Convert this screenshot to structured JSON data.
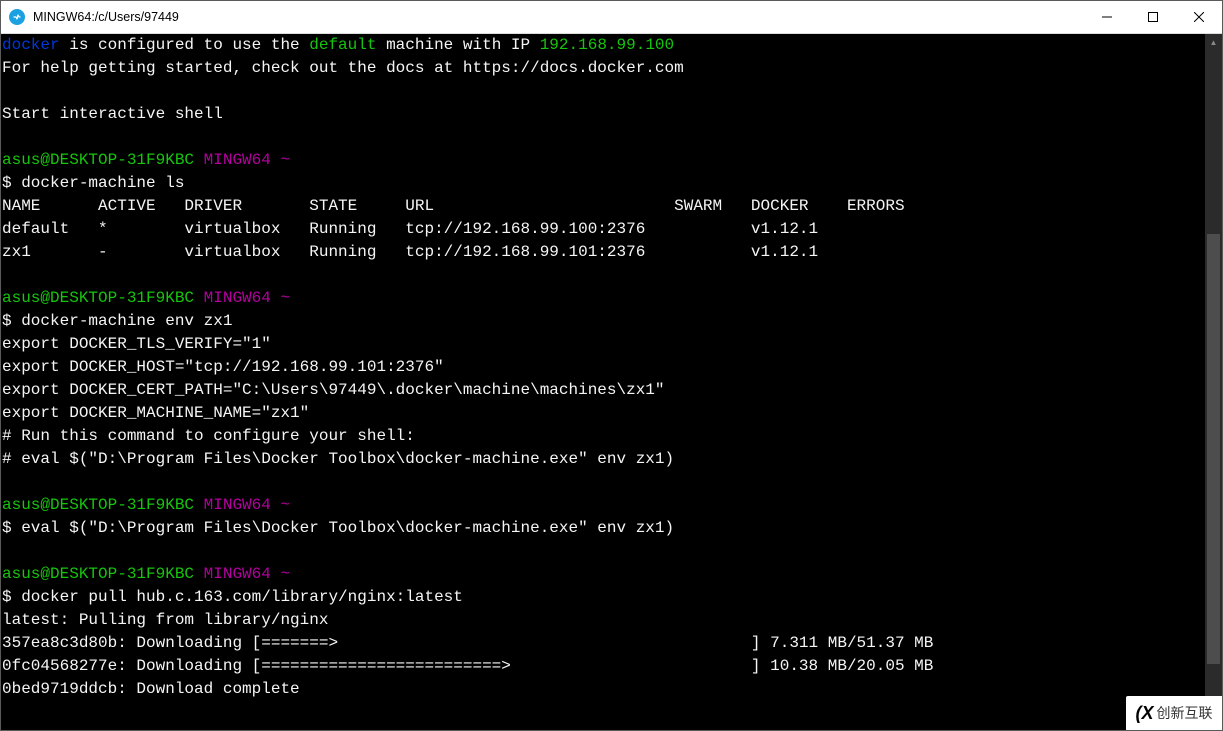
{
  "window": {
    "title": "MINGW64:/c/Users/97449"
  },
  "banner": {
    "docker_word": "docker",
    "config_text": " is configured to use the ",
    "default_word": "default",
    "machine_text": " machine with IP ",
    "ip": "192.168.99.100",
    "help_line": "For help getting started, check out the docs at https://docs.docker.com",
    "start_shell": "Start interactive shell"
  },
  "prompt": {
    "user_host": "asus@DESKTOP-31F9KBC",
    "shell": "MINGW64",
    "tilde": "~",
    "dollar": "$ "
  },
  "cmd1": "docker-machine ls",
  "ls_header": "NAME      ACTIVE   DRIVER       STATE     URL                         SWARM   DOCKER    ERRORS",
  "ls_row1": "default   *        virtualbox   Running   tcp://192.168.99.100:2376           v1.12.1",
  "ls_row2": "zx1       -        virtualbox   Running   tcp://192.168.99.101:2376           v1.12.1",
  "cmd2": "docker-machine env zx1",
  "env_out": {
    "l1": "export DOCKER_TLS_VERIFY=\"1\"",
    "l2": "export DOCKER_HOST=\"tcp://192.168.99.101:2376\"",
    "l3": "export DOCKER_CERT_PATH=\"C:\\Users\\97449\\.docker\\machine\\machines\\zx1\"",
    "l4": "export DOCKER_MACHINE_NAME=\"zx1\"",
    "l5": "# Run this command to configure your shell:",
    "l6": "# eval $(\"D:\\Program Files\\Docker Toolbox\\docker-machine.exe\" env zx1)"
  },
  "cmd3": "eval $(\"D:\\Program Files\\Docker Toolbox\\docker-machine.exe\" env zx1)",
  "cmd4": "docker pull hub.c.163.com/library/nginx:latest",
  "pull_out": {
    "l1": "latest: Pulling from library/nginx",
    "l2": "357ea8c3d80b: Downloading [=======>                                           ] 7.311 MB/51.37 MB",
    "l3": "0fc04568277e: Downloading [=========================>                         ] 10.38 MB/20.05 MB",
    "l4": "0bed9719ddcb: Download complete"
  },
  "watermark": {
    "logo": "(X",
    "text": "创新互联"
  }
}
